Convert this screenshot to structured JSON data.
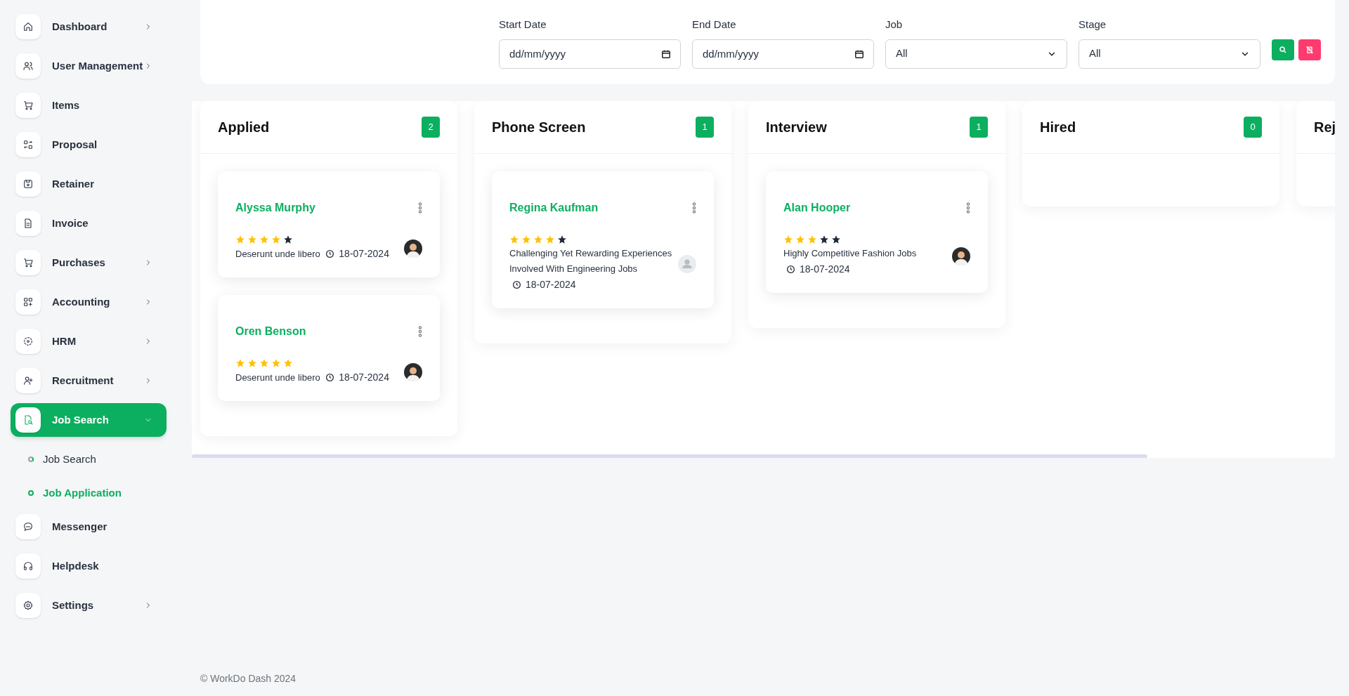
{
  "sidebar": {
    "items": [
      {
        "label": "Dashboard",
        "expandable": true,
        "selected": false
      },
      {
        "label": "User Management",
        "expandable": true,
        "selected": false
      },
      {
        "label": "Items",
        "expandable": false,
        "selected": false
      },
      {
        "label": "Proposal",
        "expandable": false,
        "selected": false
      },
      {
        "label": "Retainer",
        "expandable": false,
        "selected": false
      },
      {
        "label": "Invoice",
        "expandable": false,
        "selected": false
      },
      {
        "label": "Purchases",
        "expandable": true,
        "selected": false
      },
      {
        "label": "Accounting",
        "expandable": true,
        "selected": false
      },
      {
        "label": "HRM",
        "expandable": true,
        "selected": false
      },
      {
        "label": "Recruitment",
        "expandable": true,
        "selected": false
      },
      {
        "label": "Job Search",
        "expandable": true,
        "selected": true,
        "expanded": true,
        "children": [
          {
            "label": "Job Search",
            "selected": false
          },
          {
            "label": "Job Application",
            "selected": true
          }
        ]
      },
      {
        "label": "Messenger",
        "expandable": false,
        "selected": false
      },
      {
        "label": "Helpdesk",
        "expandable": false,
        "selected": false
      },
      {
        "label": "Settings",
        "expandable": true,
        "selected": false
      }
    ]
  },
  "filters": {
    "fields": [
      {
        "kind": "date",
        "label": "Start Date",
        "placeholder": "dd/mm/yyyy"
      },
      {
        "kind": "date",
        "label": "End Date",
        "placeholder": "dd/mm/yyyy"
      },
      {
        "kind": "select",
        "label": "Job",
        "value": "All"
      },
      {
        "kind": "select",
        "label": "Stage",
        "value": "All"
      }
    ]
  },
  "board": {
    "columns": [
      {
        "title": "Applied",
        "count": "2",
        "cards": [
          {
            "kind": "photo",
            "name": "Alyssa Murphy",
            "stars": 4,
            "job": "Deserunt unde libero",
            "date": "18-07-2024"
          },
          {
            "kind": "photo",
            "name": "Oren Benson",
            "stars": 5,
            "job": "Deserunt unde libero",
            "date": "18-07-2024"
          }
        ]
      },
      {
        "title": "Phone Screen",
        "count": "1",
        "cards": [
          {
            "kind": "placeholder",
            "name": "Regina Kaufman",
            "stars": 4,
            "job": "Challenging Yet Rewarding Experiences Involved With Engineering Jobs",
            "date": "18-07-2024"
          }
        ]
      },
      {
        "title": "Interview",
        "count": "1",
        "cards": [
          {
            "kind": "photo",
            "name": "Alan Hooper",
            "stars": 3,
            "job": "Highly Competitive Fashion Jobs",
            "date": "18-07-2024"
          }
        ]
      },
      {
        "title": "Hired",
        "count": "0"
      },
      {
        "title": "Rej"
      }
    ]
  },
  "footer": "© WorkDo Dash 2024"
}
